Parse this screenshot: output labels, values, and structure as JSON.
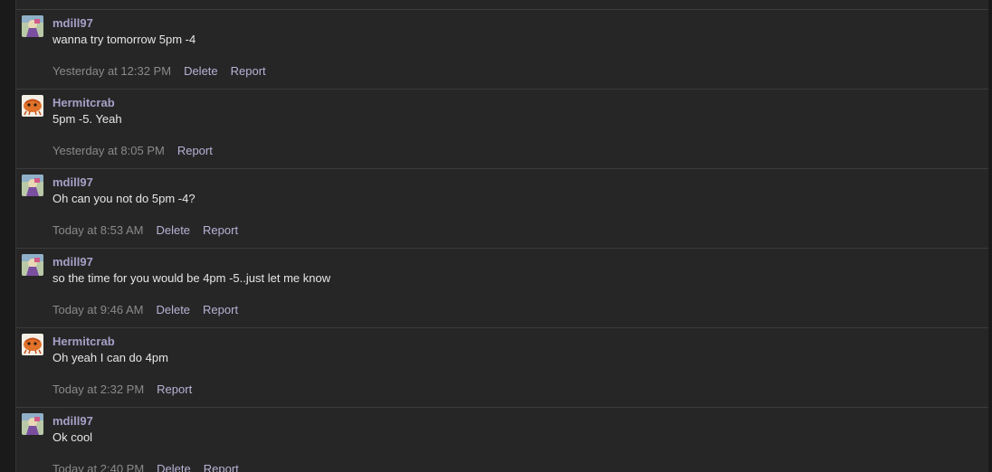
{
  "actions": {
    "delete_label": "Delete",
    "report_label": "Report"
  },
  "messages": [
    {
      "user": "mdill97",
      "avatar": "mdill97-avatar",
      "text": "wanna try tomorrow 5pm -4",
      "time": "Yesterday at 12:32 PM",
      "can_delete": true
    },
    {
      "user": "Hermitcrab",
      "avatar": "hermitcrab-avatar",
      "text": "5pm -5. Yeah",
      "time": "Yesterday at 8:05 PM",
      "can_delete": false
    },
    {
      "user": "mdill97",
      "avatar": "mdill97-avatar",
      "text": "Oh can you not do 5pm -4?",
      "time": "Today at 8:53 AM",
      "can_delete": true
    },
    {
      "user": "mdill97",
      "avatar": "mdill97-avatar",
      "text": "so the time for you would be 4pm -5..just let me know",
      "time": "Today at 9:46 AM",
      "can_delete": true
    },
    {
      "user": "Hermitcrab",
      "avatar": "hermitcrab-avatar",
      "text": "Oh yeah I can do 4pm",
      "time": "Today at 2:32 PM",
      "can_delete": false
    },
    {
      "user": "mdill97",
      "avatar": "mdill97-avatar",
      "text": "Ok cool",
      "time": "Today at 2:40 PM",
      "can_delete": true
    }
  ],
  "colors": {
    "username": "#a7a0c8",
    "message_text": "#e6e6e6",
    "timestamp": "#8a8a8a",
    "action_link": "#b8b2d6",
    "background": "#262626"
  }
}
